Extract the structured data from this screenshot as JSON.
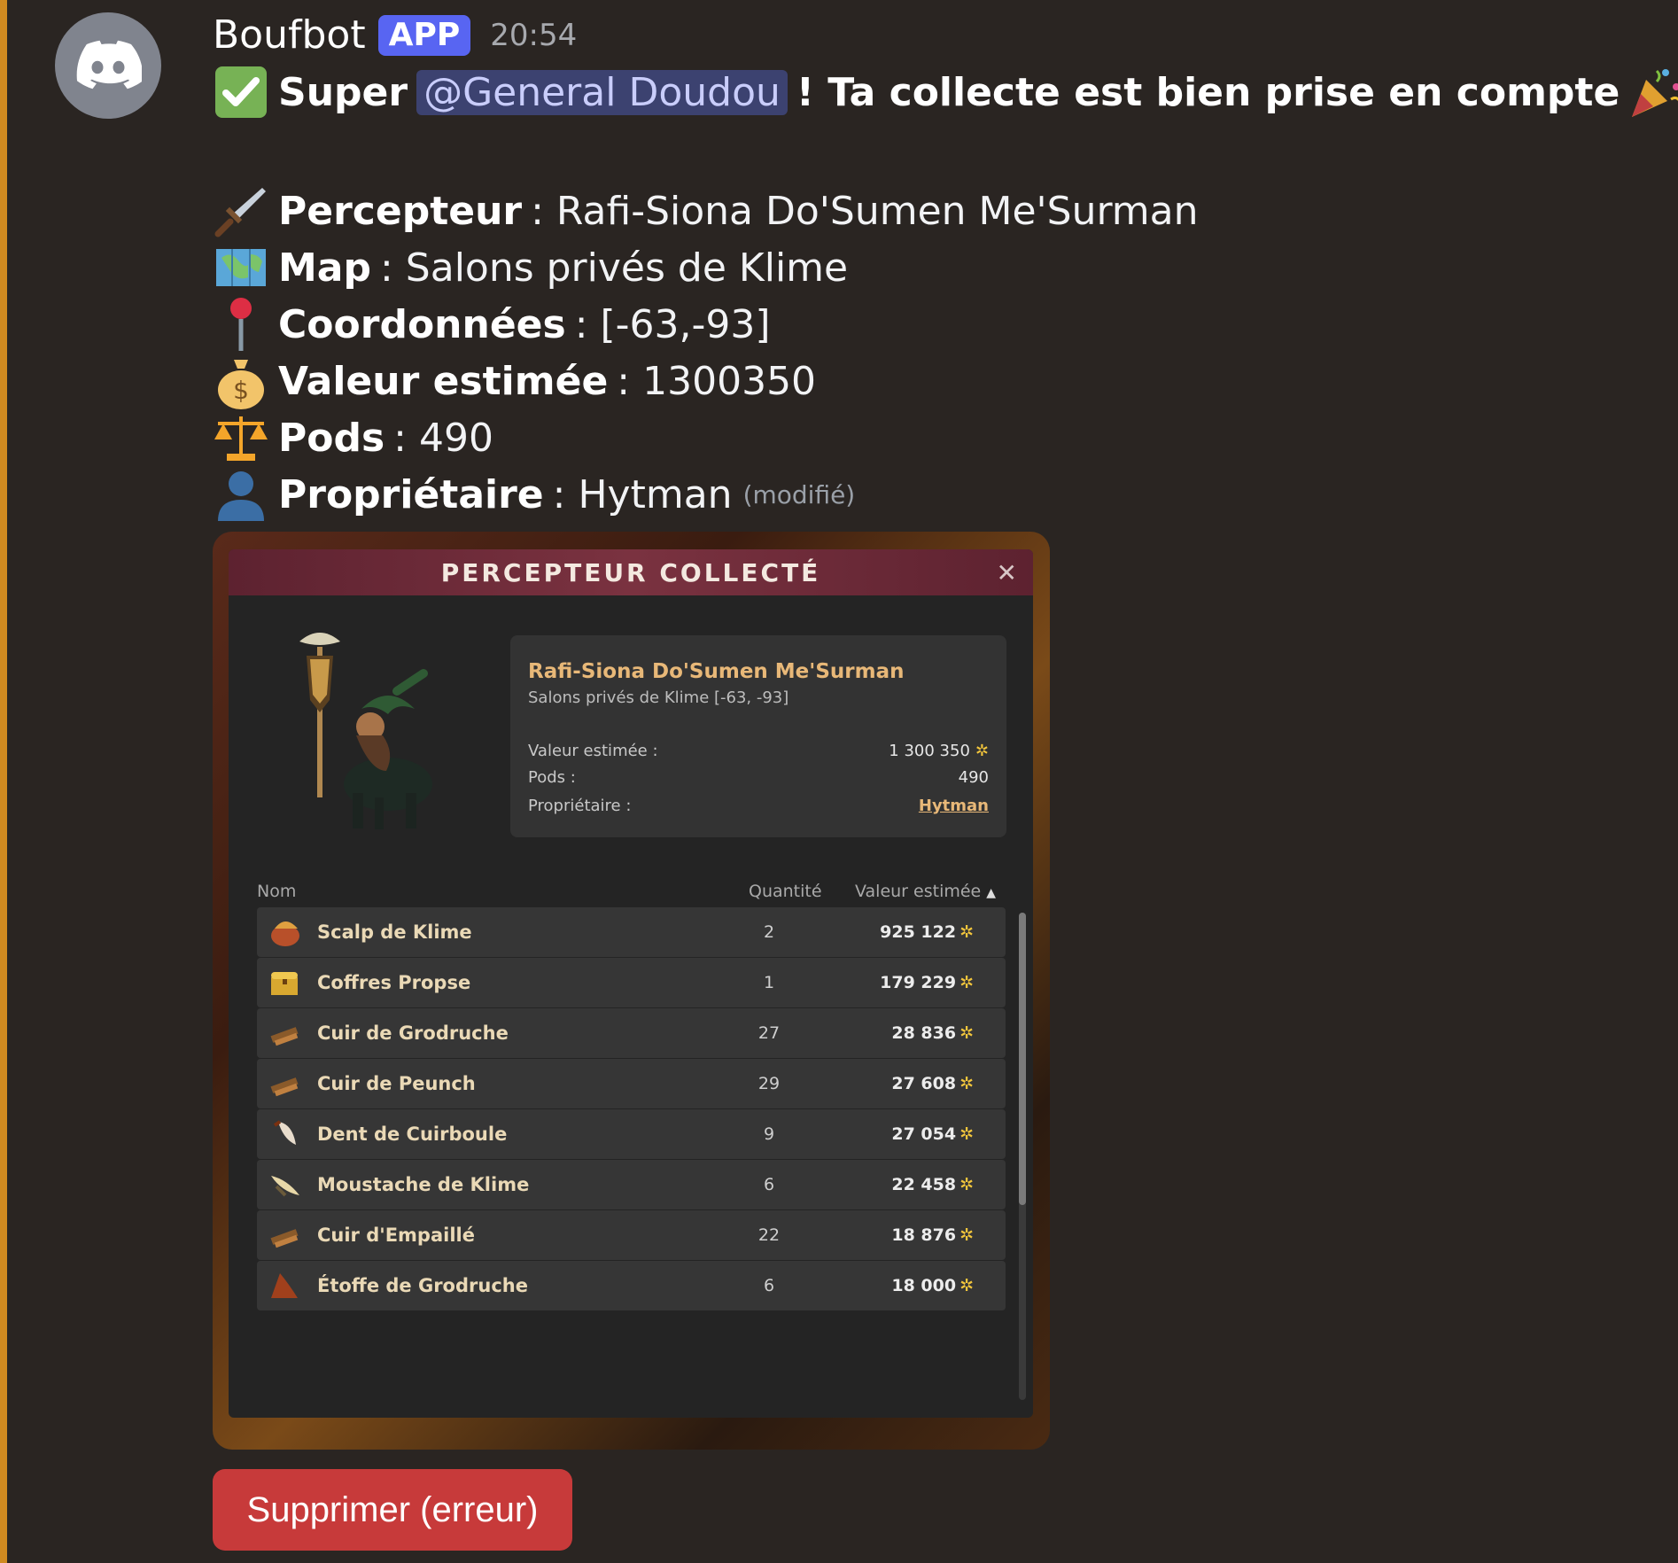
{
  "message": {
    "author": "Boufbot",
    "badge": "APP",
    "timestamp": "20:54",
    "headline": {
      "prefix": "Super",
      "mention": "@General Doudou",
      "suffix": "! Ta collecte est bien prise en compte"
    },
    "fields": [
      {
        "icon": "dagger-icon",
        "label": "Percepteur",
        "value": ": Rafi-Siona Do'Sumen Me'Surman"
      },
      {
        "icon": "world-map-icon",
        "label": "Map",
        "value": ": Salons privés de Klime"
      },
      {
        "icon": "pin-icon",
        "label": "Coordonnées",
        "value": ": [-63,-93]"
      },
      {
        "icon": "money-bag-icon",
        "label": "Valeur estimée",
        "value": ": 1300350"
      },
      {
        "icon": "scales-icon",
        "label": "Pods",
        "value": ": 490"
      },
      {
        "icon": "person-icon",
        "label": "Propriétaire",
        "value": ": Hytman"
      }
    ],
    "edited": "(modifié)",
    "delete_button": "Supprimer (erreur)"
  },
  "panel": {
    "title": "PERCEPTEUR COLLECTÉ",
    "close": "✕",
    "name": "Rafi-Siona Do'Sumen Me'Surman",
    "location": "Salons privés de Klime [-63, -93]",
    "value_label": "Valeur estimée :",
    "value": "1 300 350",
    "pods_label": "Pods :",
    "pods": "490",
    "owner_label": "Propriétaire :",
    "owner": "Hytman",
    "columns": {
      "name": "Nom",
      "quantity": "Quantité",
      "value": "Valeur estimée"
    },
    "items": [
      {
        "name": "Scalp de Klime",
        "qty": "2",
        "value": "925 122",
        "icon": "scalp-icon"
      },
      {
        "name": "Coffres Propse",
        "qty": "1",
        "value": "179 229",
        "icon": "chest-icon"
      },
      {
        "name": "Cuir de Grodruche",
        "qty": "27",
        "value": "28 836",
        "icon": "leather-icon"
      },
      {
        "name": "Cuir de Peunch",
        "qty": "29",
        "value": "27 608",
        "icon": "leather-icon"
      },
      {
        "name": "Dent de Cuirboule",
        "qty": "9",
        "value": "27 054",
        "icon": "tooth-icon"
      },
      {
        "name": "Moustache de Klime",
        "qty": "6",
        "value": "22 458",
        "icon": "moustache-icon"
      },
      {
        "name": "Cuir d'Empaillé",
        "qty": "22",
        "value": "18 876",
        "icon": "leather-icon"
      },
      {
        "name": "Étoffe de Grodruche",
        "qty": "6",
        "value": "18 000",
        "icon": "cloth-icon"
      }
    ]
  },
  "colors": {
    "accent": "#d08a20",
    "badge": "#5865f2",
    "delete": "#c73a3a",
    "mention_bg": "#3c4270",
    "item_name": "#ead9b6",
    "kama": "#f3c63c"
  }
}
